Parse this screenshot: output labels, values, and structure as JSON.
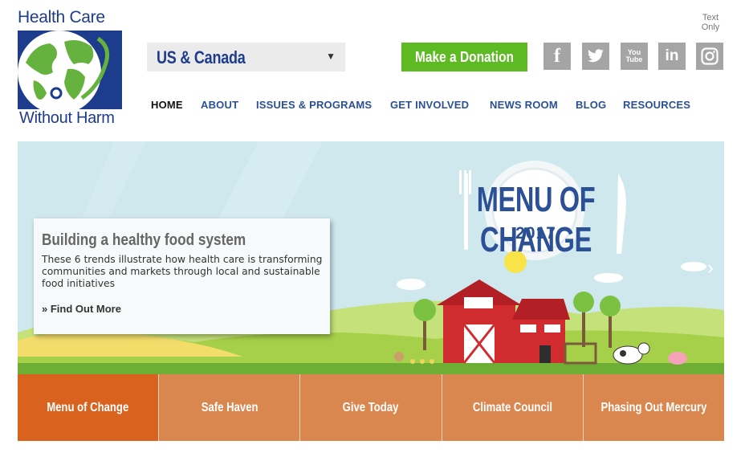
{
  "logo": {
    "line1": "Health Care",
    "line2": "Without Harm"
  },
  "text_only": {
    "line1": "Text",
    "line2": "Only"
  },
  "region_select": {
    "value": "US & Canada",
    "caret": "▼"
  },
  "donate_button": "Make a Donation",
  "social": [
    {
      "icon": "facebook-icon",
      "glyph": "f"
    },
    {
      "icon": "twitter-icon",
      "glyph": "t"
    },
    {
      "icon": "youtube-icon",
      "glyph": "You\nTube"
    },
    {
      "icon": "linkedin-icon",
      "glyph": "in"
    },
    {
      "icon": "instagram-icon",
      "glyph": "◎"
    }
  ],
  "nav": [
    "HOME",
    "ABOUT",
    "ISSUES & PROGRAMS",
    "GET INVOLVED",
    "NEWS ROOM",
    "BLOG",
    "RESOURCES"
  ],
  "hero": {
    "title": "Building a healthy food system",
    "description": "These 6 trends illustrate how health care is transforming communities and markets through local and sustainable food initiatives",
    "link": "» Find Out More",
    "banner_title": "MENU OF CHANGE",
    "banner_year": "2017",
    "next_arrow": "›"
  },
  "tabs": [
    "Menu of Change",
    "Safe Haven",
    "Give Today",
    "Climate Council",
    "Phasing Out Mercury"
  ],
  "colors": {
    "brand_blue": "#1e3c8c",
    "nav_blue": "#2b5096",
    "donate_green": "#5dba23",
    "tab_orange": "#d9874f",
    "tab_active": "#d9621f",
    "social_gray": "#a5a5a5"
  }
}
